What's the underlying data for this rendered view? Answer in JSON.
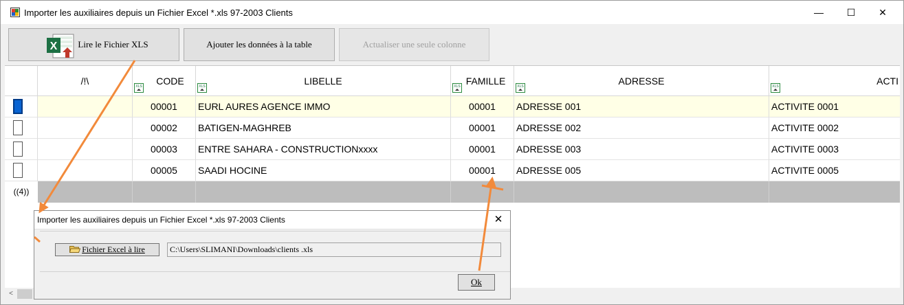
{
  "window": {
    "title": "Importer les auxiliaires depuis un Fichier Excel *.xls 97-2003 Clients",
    "controls": {
      "minimize": "—",
      "maximize": "☐",
      "close": "✕"
    }
  },
  "toolbar": {
    "read_xls_label": "Lire le Fichier XLS",
    "add_data_label": "Ajouter les données à la table",
    "refresh_column_label": "Actualiser une seule colonne",
    "excel_color": "#1d7044"
  },
  "grid": {
    "columns": [
      {
        "key": "flag",
        "label": "/!\\",
        "xls": false
      },
      {
        "key": "code",
        "label": "CODE",
        "xls": true
      },
      {
        "key": "libelle",
        "label": "LIBELLE",
        "xls": true
      },
      {
        "key": "famille",
        "label": "FAMILLE",
        "xls": true
      },
      {
        "key": "adresse",
        "label": "ADRESSE",
        "xls": true
      },
      {
        "key": "activite",
        "label": "ACTI",
        "xls": true
      }
    ],
    "rows": [
      {
        "selected": true,
        "flag": "",
        "code": "00001",
        "libelle": "EURL AURES AGENCE IMMO",
        "famille": "00001",
        "adresse": "ADRESSE 001",
        "activite": "ACTIVITE 0001"
      },
      {
        "selected": false,
        "flag": "",
        "code": "00002",
        "libelle": "BATIGEN-MAGHREB",
        "famille": "00001",
        "adresse": "ADRESSE 002",
        "activite": "ACTIVITE 0002"
      },
      {
        "selected": false,
        "flag": "",
        "code": "00003",
        "libelle": "ENTRE SAHARA - CONSTRUCTIONxxxx",
        "famille": "00001",
        "adresse": "ADRESSE 003",
        "activite": "ACTIVITE 0003"
      },
      {
        "selected": false,
        "flag": "",
        "code": "00005",
        "libelle": "SAADI HOCINE",
        "famille": "00001",
        "adresse": "ADRESSE 005",
        "activite": "ACTIVITE 0005"
      }
    ],
    "summary_label": "((4))",
    "xls_icon_text": "XLS",
    "selected_row_color": "#ffffe6",
    "summary_color": "#bdbdbd"
  },
  "hscroll": {
    "left_arrow": "<"
  },
  "dialog": {
    "title": "Importer les auxiliaires depuis un Fichier Excel *.xls 97-2003 Clients",
    "close": "✕",
    "file_button_label": "Fichier Excel à lire",
    "file_path": "C:\\Users\\SLIMANI\\Downloads\\clients .xls",
    "ok_label": "Ok"
  },
  "annotation": {
    "arrow_color": "#f28a3b"
  }
}
